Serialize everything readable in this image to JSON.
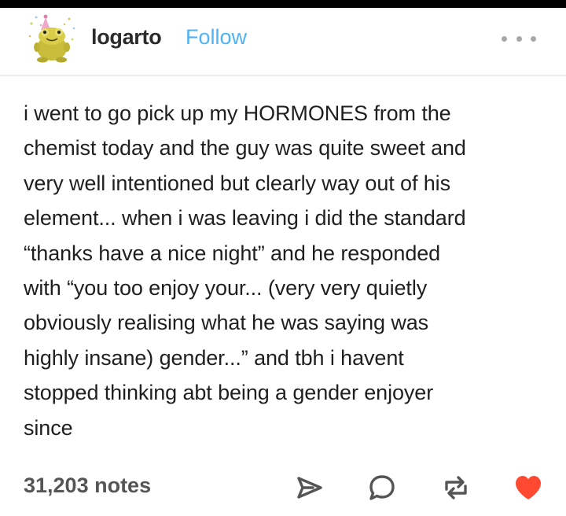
{
  "post": {
    "username": "logarto",
    "follow_label": "Follow",
    "body_lines": [
      "i went to go pick up my HORMONES from the",
      "chemist today and the guy was quite sweet and",
      "very well intentioned but clearly way out of his",
      "element... when i was leaving i did the standard",
      "“thanks have a nice night” and he responded",
      "with “you too enjoy your... (very very quietly",
      "obviously realising what he was saying was",
      "highly insane) gender...” and tbh i havent",
      "stopped thinking abt being a gender enjoyer",
      "since"
    ],
    "notes": "31,203 notes"
  },
  "icons": {
    "avatar": "frog-party-hat-avatar",
    "more": "ellipsis-icon",
    "share": "share-icon",
    "reply": "reply-icon",
    "reblog": "reblog-icon",
    "like": "heart-icon"
  },
  "colors": {
    "follow": "#4fb3f6",
    "icon_gray": "#555555",
    "heart": "#ff4930",
    "top_bar": "#000000"
  }
}
